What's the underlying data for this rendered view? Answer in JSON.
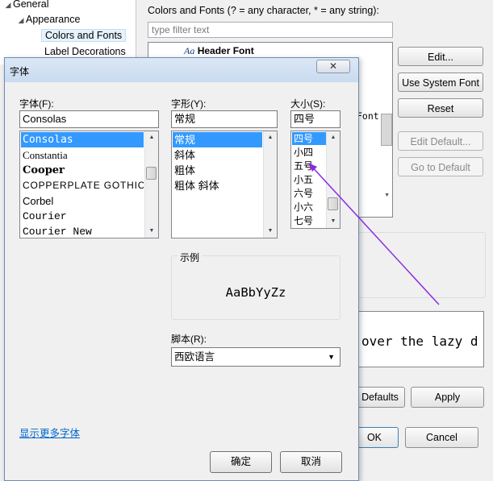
{
  "bg": {
    "tree": [
      {
        "label": "General",
        "expanded": true
      },
      {
        "label": "Appearance",
        "expanded": true
      },
      {
        "label": "Colors and Fonts"
      },
      {
        "label": "Label Decorations"
      }
    ],
    "filter_label": "Colors and Fonts (? = any character, * = any string):",
    "filter_placeholder": "type filter text",
    "list_item": "Header Font",
    "list_item_icon": "Aa",
    "list_peek": "Font",
    "buttons": {
      "edit": "Edit...",
      "use_system_font": "Use System Font",
      "reset": "Reset",
      "edit_default": "Edit Default...",
      "go_to_default": "Go to Default"
    },
    "preview_text": "over the lazy d",
    "restore_defaults": "Defaults",
    "apply": "Apply",
    "ok": "OK",
    "cancel": "Cancel"
  },
  "dialog": {
    "title": "字体",
    "close": "✕",
    "font_label": "字体(F):",
    "font_value": "Consolas",
    "fonts": [
      "Consolas",
      "Constantia",
      "Cooper",
      "COPPERPLATE GOTHIC",
      "Corbel",
      "Courier",
      "Courier New"
    ],
    "style_label": "字形(Y):",
    "style_value": "常规",
    "styles": [
      "常规",
      "斜体",
      "粗体",
      "粗体 斜体"
    ],
    "size_label": "大小(S):",
    "size_value": "四号",
    "sizes": [
      "四号",
      "小四",
      "五号",
      "小五",
      "六号",
      "小六",
      "七号"
    ],
    "sample_label": "示例",
    "sample_text": "AaBbYyZz",
    "script_label": "脚本(R):",
    "script_value": "西欧语言",
    "more_fonts": "显示更多字体",
    "ok": "确定",
    "cancel": "取消"
  },
  "colors": {
    "selection": "#3399ff",
    "link": "#0066cc",
    "annotation_arrow": "#8a2be2"
  }
}
